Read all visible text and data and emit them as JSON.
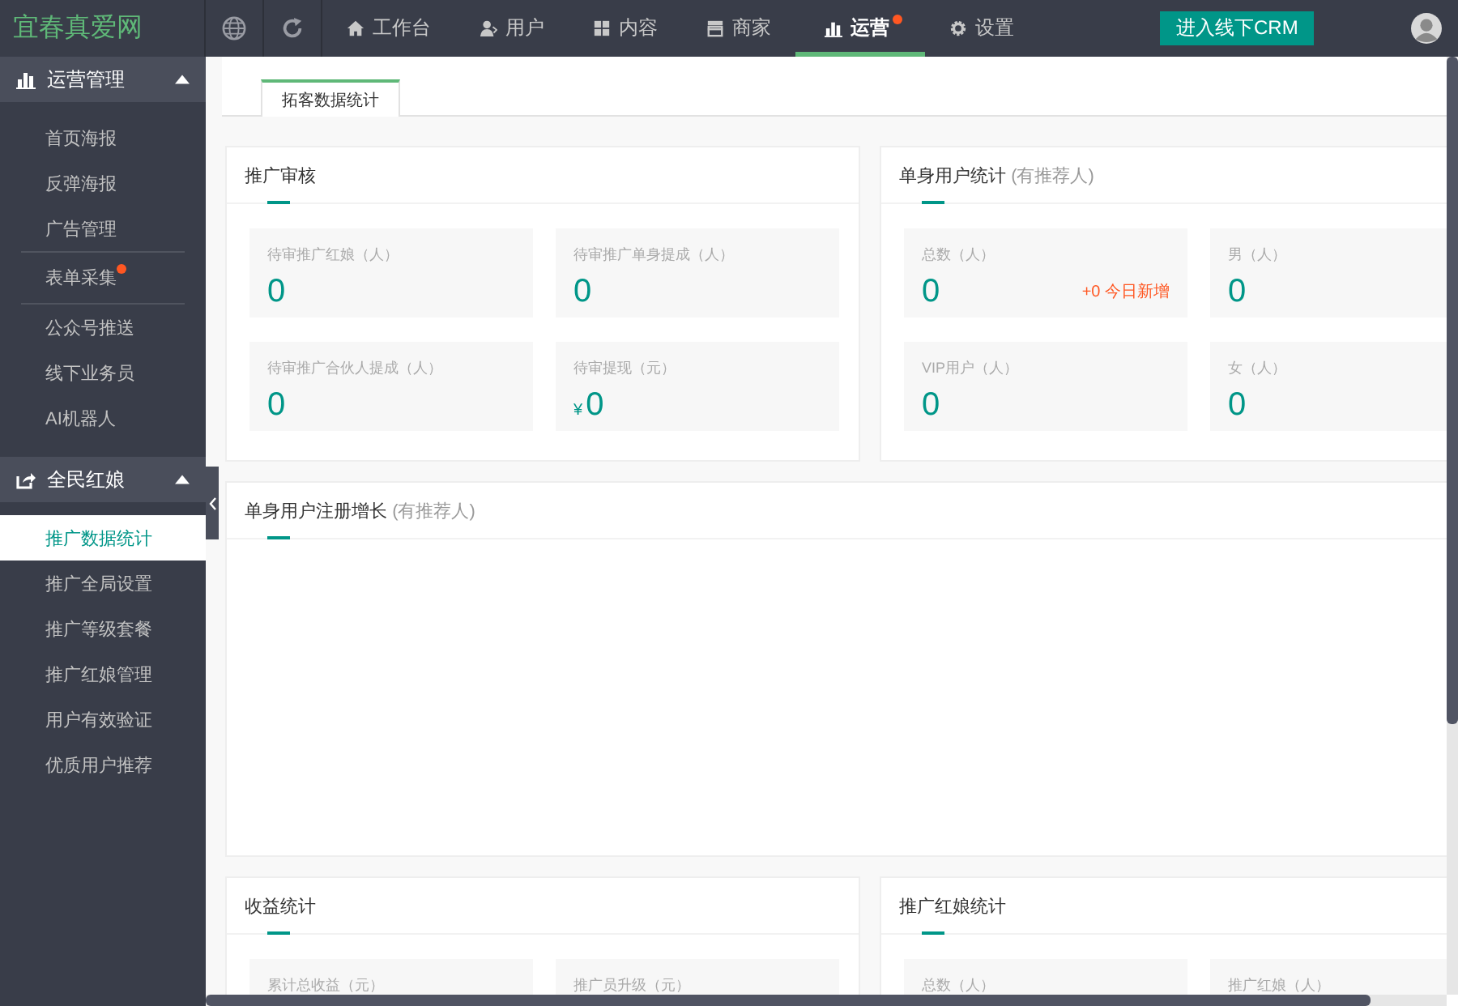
{
  "header": {
    "logo": "宜春真爱网",
    "nav": [
      {
        "label": "工作台",
        "selected": false,
        "dot": false
      },
      {
        "label": "用户",
        "selected": false,
        "dot": false
      },
      {
        "label": "内容",
        "selected": false,
        "dot": false
      },
      {
        "label": "商家",
        "selected": false,
        "dot": false
      },
      {
        "label": "运营",
        "selected": true,
        "dot": true
      },
      {
        "label": "设置",
        "selected": false,
        "dot": false
      }
    ],
    "crm_button": "进入线下CRM"
  },
  "sidebar": {
    "groups": [
      {
        "title": "运营管理",
        "expanded": true,
        "items": [
          {
            "label": "首页海报",
            "selected": false,
            "dot": false,
            "separated": false
          },
          {
            "label": "反弹海报",
            "selected": false,
            "dot": false,
            "separated": false
          },
          {
            "label": "广告管理",
            "selected": false,
            "dot": false,
            "separated": false
          },
          {
            "label": "表单采集",
            "selected": false,
            "dot": true,
            "separated": true
          },
          {
            "label": "公众号推送",
            "selected": false,
            "dot": false,
            "separated": false
          },
          {
            "label": "线下业务员",
            "selected": false,
            "dot": false,
            "separated": false
          },
          {
            "label": "AI机器人",
            "selected": false,
            "dot": false,
            "separated": false
          }
        ]
      },
      {
        "title": "全民红娘",
        "expanded": true,
        "items": [
          {
            "label": "推广数据统计",
            "selected": true,
            "dot": false,
            "separated": false
          },
          {
            "label": "推广全局设置",
            "selected": false,
            "dot": false,
            "separated": false
          },
          {
            "label": "推广等级套餐",
            "selected": false,
            "dot": false,
            "separated": false
          },
          {
            "label": "推广红娘管理",
            "selected": false,
            "dot": false,
            "separated": false
          },
          {
            "label": "用户有效验证",
            "selected": false,
            "dot": false,
            "separated": false
          },
          {
            "label": "优质用户推荐",
            "selected": false,
            "dot": false,
            "separated": false
          }
        ]
      }
    ]
  },
  "tabs": [
    {
      "label": "拓客数据统计",
      "selected": true
    }
  ],
  "panels": [
    {
      "kind": "stats",
      "title": "推广审核",
      "stats": [
        {
          "label": "待审推广红娘（人）",
          "value": "0"
        },
        {
          "label": "待审推广单身提成（人）",
          "value": "0"
        },
        {
          "label": "待审推广合伙人提成（人）",
          "value": "0"
        },
        {
          "label": "待审提现（元）",
          "prefix": "¥",
          "value": "0"
        }
      ]
    },
    {
      "kind": "stats",
      "title": "单身用户统计",
      "subtitle": "(有推荐人)",
      "stats": [
        {
          "label": "总数（人）",
          "value": "0",
          "note": "+0 今日新增"
        },
        {
          "label": "男（人）",
          "value": "0"
        },
        {
          "label": "VIP用户（人）",
          "value": "0"
        },
        {
          "label": "女（人）",
          "value": "0"
        }
      ]
    },
    {
      "kind": "chart",
      "title": "单身用户注册增长",
      "subtitle": "(有推荐人)"
    },
    {
      "kind": "stats",
      "title": "收益统计",
      "stats": [
        {
          "label": "累计总收益（元）"
        },
        {
          "label": "推广员升级（元）"
        }
      ]
    },
    {
      "kind": "stats",
      "title": "推广红娘统计",
      "stats": [
        {
          "label": "总数（人）"
        },
        {
          "label": "推广红娘（人）"
        }
      ]
    }
  ]
}
